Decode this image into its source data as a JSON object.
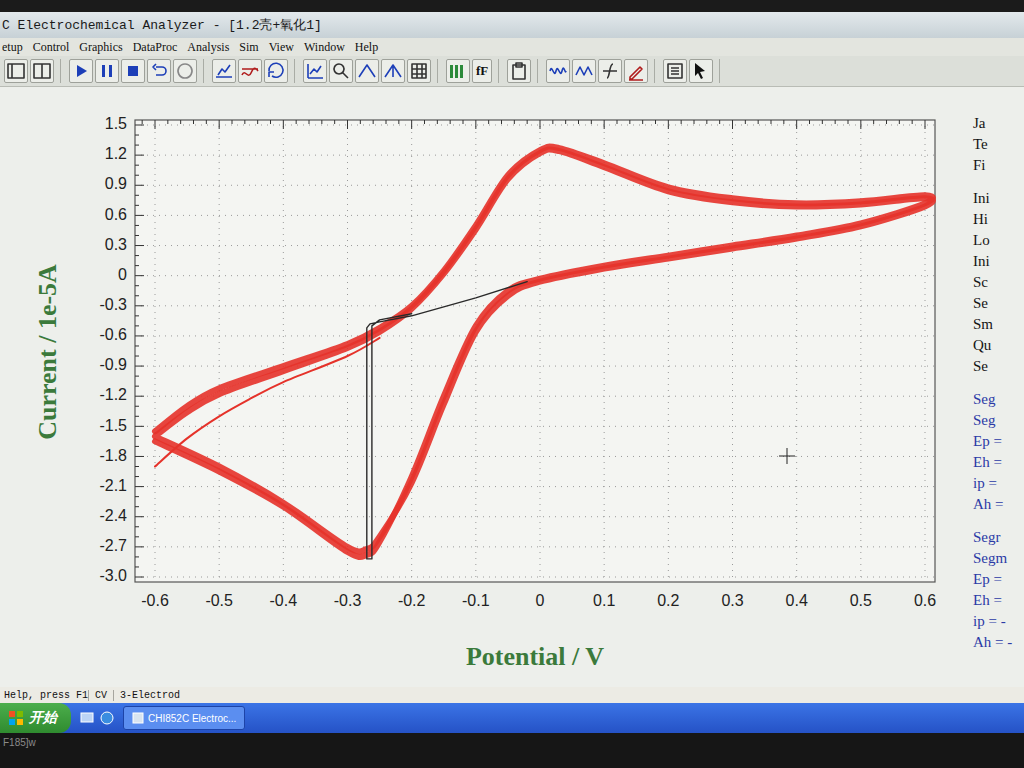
{
  "window": {
    "title": "C Electrochemical Analyzer - [1.2壳+氧化1]"
  },
  "menu": [
    "etup",
    "Control",
    "Graphics",
    "DataProc",
    "Analysis",
    "Sim",
    "View",
    "Window",
    "Help"
  ],
  "toolbar": {
    "text_button": "fF"
  },
  "chart": {
    "y_axis": {
      "label": "Current / 1e-5A",
      "ticks": [
        "1.5",
        "1.2",
        "0.9",
        "0.6",
        "0.3",
        "0",
        "-0.3",
        "-0.6",
        "-0.9",
        "-1.2",
        "-1.5",
        "-1.8",
        "-2.1",
        "-2.4",
        "-2.7",
        "-3.0"
      ]
    },
    "x_axis": {
      "label": "Potential / V",
      "ticks": [
        "-0.6",
        "-0.5",
        "-0.4",
        "-0.3",
        "-0.2",
        "-0.1",
        "0",
        "0.1",
        "0.2",
        "0.3",
        "0.4",
        "0.5",
        "0.6"
      ]
    },
    "series": [
      {
        "kind": "cv",
        "color": "#e5322a",
        "x": [
          -0.6,
          -0.55,
          -0.5,
          -0.4,
          -0.3,
          -0.25,
          -0.2,
          -0.15,
          -0.1,
          -0.05,
          0,
          0.03,
          0.1,
          0.2,
          0.3,
          0.4,
          0.5,
          0.6,
          0.6,
          0.5,
          0.4,
          0.3,
          0.2,
          0.1,
          0,
          -0.05,
          -0.1,
          -0.15,
          -0.2,
          -0.25,
          -0.27,
          -0.3,
          -0.4,
          -0.5,
          -0.6
        ],
        "y": [
          -1.55,
          -1.3,
          -1.12,
          -0.9,
          -0.68,
          -0.52,
          -0.3,
          0.05,
          0.5,
          1.0,
          1.25,
          1.27,
          1.12,
          0.88,
          0.77,
          0.72,
          0.74,
          0.8,
          0.72,
          0.52,
          0.4,
          0.3,
          0.2,
          0.1,
          -0.03,
          -0.15,
          -0.5,
          -1.2,
          -2.0,
          -2.65,
          -2.78,
          -2.75,
          -2.3,
          -1.95,
          -1.65
        ]
      },
      {
        "kind": "cv",
        "color": "#e5322a",
        "x": [
          -0.6,
          -0.55,
          -0.5,
          -0.4,
          -0.3,
          -0.25,
          -0.2,
          -0.15,
          -0.1,
          -0.05,
          0,
          0.03,
          0.1,
          0.2,
          0.3,
          0.4,
          0.5,
          0.6,
          0.6,
          0.5,
          0.4,
          0.3,
          0.2,
          0.1,
          0,
          -0.05,
          -0.1,
          -0.15,
          -0.2,
          -0.25,
          -0.27,
          -0.3,
          -0.4,
          -0.5,
          -0.6
        ],
        "y": [
          -1.6,
          -1.36,
          -1.18,
          -0.95,
          -0.72,
          -0.56,
          -0.33,
          0.02,
          0.46,
          0.96,
          1.22,
          1.24,
          1.08,
          0.84,
          0.73,
          0.69,
          0.71,
          0.77,
          0.69,
          0.49,
          0.37,
          0.27,
          0.17,
          0.07,
          -0.06,
          -0.2,
          -0.56,
          -1.28,
          -2.06,
          -2.6,
          -2.72,
          -2.7,
          -2.26,
          -1.9,
          -1.6
        ]
      },
      {
        "kind": "cv-thin",
        "color": "#e5322a",
        "x": [
          -0.6,
          -0.55,
          -0.5,
          -0.45,
          -0.4,
          -0.3,
          -0.25
        ],
        "y": [
          -1.9,
          -1.62,
          -1.4,
          -1.22,
          -1.06,
          -0.8,
          -0.62
        ]
      },
      {
        "kind": "trace",
        "color": "#2a2a2a",
        "x": [
          -0.02,
          -0.1,
          -0.2,
          -0.25,
          -0.265,
          -0.27,
          -0.27,
          -0.262,
          -0.262,
          -0.25,
          -0.2
        ],
        "y": [
          -0.06,
          -0.22,
          -0.4,
          -0.46,
          -0.48,
          -0.52,
          -2.82,
          -2.82,
          -0.5,
          -0.44,
          -0.38
        ]
      }
    ]
  },
  "info_panel": {
    "groups": [
      {
        "color": "#141414",
        "lines": [
          "Ja",
          "Te",
          "Fi"
        ]
      },
      {
        "color": "#141414",
        "lines": [
          "Ini",
          "Hi",
          "Lo",
          "Ini",
          "Sc",
          "Se",
          "Sm",
          "Qu",
          "Se"
        ]
      },
      {
        "color": "#2b3aa6",
        "lines": [
          "Seg",
          "Seg",
          "Ep =",
          "Eh =",
          "ip =",
          "Ah ="
        ]
      },
      {
        "color": "#2b3aa6",
        "lines": [
          "Segr",
          "Segm",
          "Ep =",
          "Eh =",
          "ip = -",
          "Ah = -"
        ]
      }
    ]
  },
  "status_bar": {
    "help": "Help, press F1",
    "panes": [
      "CV",
      "3-Electrod"
    ]
  },
  "taskbar": {
    "start": "开始",
    "tasks": [
      {
        "label": "CHI852C Electroc...",
        "selected": false
      }
    ]
  },
  "bezel_text": "F185]w"
}
